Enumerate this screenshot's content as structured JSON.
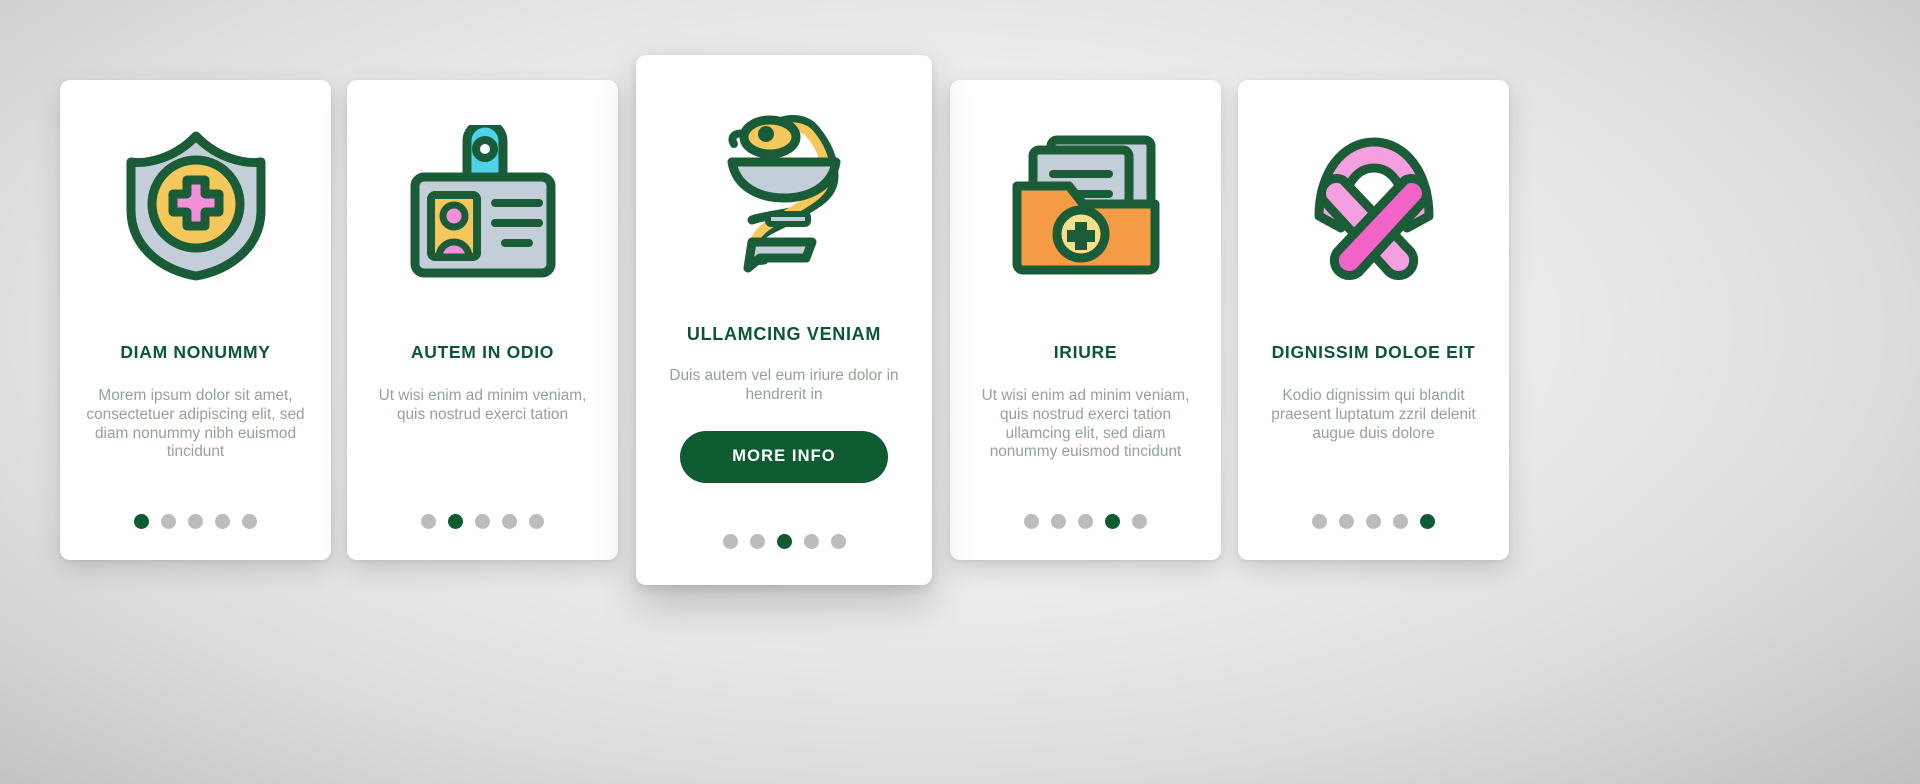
{
  "palette": {
    "green_dark": "#0f5c33",
    "green_title": "#0b5733",
    "body_text": "#93a396",
    "dot_inactive": "#bcbcbc",
    "card_bg": "#ffffff",
    "page_bg": "#dcdcdc",
    "yellow": "#f6c75a",
    "pink": "#f48fd9",
    "pink_light": "#f69fe0",
    "blue_gray": "#c3ced9",
    "cyan": "#4ed2ea",
    "orange": "#f59b45"
  },
  "cards": [
    {
      "id": "card-1",
      "icon": "medical-shield-icon",
      "title": "DIAM NONUMMY",
      "body": "Morem ipsum dolor sit amet, consectetuer adipiscing elit, sed diam nonummy nibh euismod tincidunt",
      "dots": {
        "count": 5,
        "active_index": 0
      },
      "featured": false,
      "button": null
    },
    {
      "id": "card-2",
      "icon": "id-badge-icon",
      "title": "AUTEM IN ODIO",
      "body": "Ut wisi enim ad minim veniam, quis nostrud exerci tation",
      "dots": {
        "count": 5,
        "active_index": 1
      },
      "featured": false,
      "button": null
    },
    {
      "id": "card-3",
      "icon": "bowl-of-hygieia-icon",
      "title": "ULLAMCING VENIAM",
      "body": "Duis autem vel eum iriure dolor in hendrerit in",
      "dots": {
        "count": 5,
        "active_index": 2
      },
      "featured": true,
      "button": {
        "label": "MORE INFO"
      }
    },
    {
      "id": "card-4",
      "icon": "medical-folder-icon",
      "title": "IRIURE",
      "body": "Ut wisi enim ad minim veniam, quis nostrud exerci tation ullamcing elit, sed diam nonummy euismod tincidunt",
      "dots": {
        "count": 5,
        "active_index": 3
      },
      "featured": false,
      "button": null
    },
    {
      "id": "card-5",
      "icon": "awareness-ribbon-icon",
      "title": "DIGNISSIM DOLOE EIT",
      "body": "Kodio dignissim qui blandit praesent luptatum zzril delenit augue duis dolore",
      "dots": {
        "count": 5,
        "active_index": 4
      },
      "featured": false,
      "button": null
    }
  ]
}
